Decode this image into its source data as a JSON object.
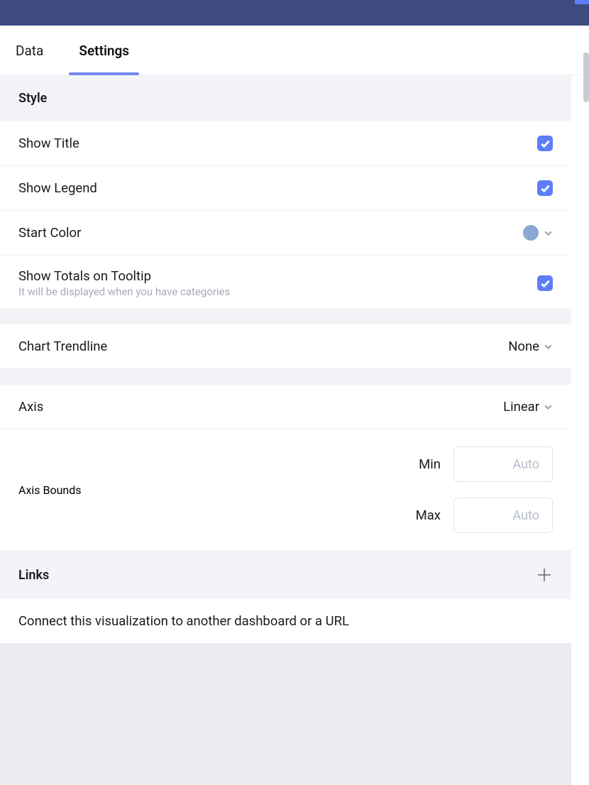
{
  "tabs": {
    "data": "Data",
    "settings": "Settings"
  },
  "sections": {
    "style": "Style",
    "links": "Links"
  },
  "style": {
    "show_title": {
      "label": "Show Title",
      "checked": true
    },
    "show_legend": {
      "label": "Show Legend",
      "checked": true
    },
    "start_color": {
      "label": "Start Color",
      "value": "#8aa9d0"
    },
    "show_totals": {
      "label": "Show Totals on Tooltip",
      "subtitle": "It will be displayed when you have categories",
      "checked": true
    },
    "chart_trendline": {
      "label": "Chart Trendline",
      "value": "None"
    },
    "axis": {
      "label": "Axis",
      "value": "Linear"
    },
    "axis_bounds": {
      "label": "Axis Bounds",
      "min_label": "Min",
      "min_value": "",
      "min_placeholder": "Auto",
      "max_label": "Max",
      "max_value": "",
      "max_placeholder": "Auto"
    }
  },
  "links": {
    "description": "Connect this visualization to another dashboard or a URL"
  }
}
